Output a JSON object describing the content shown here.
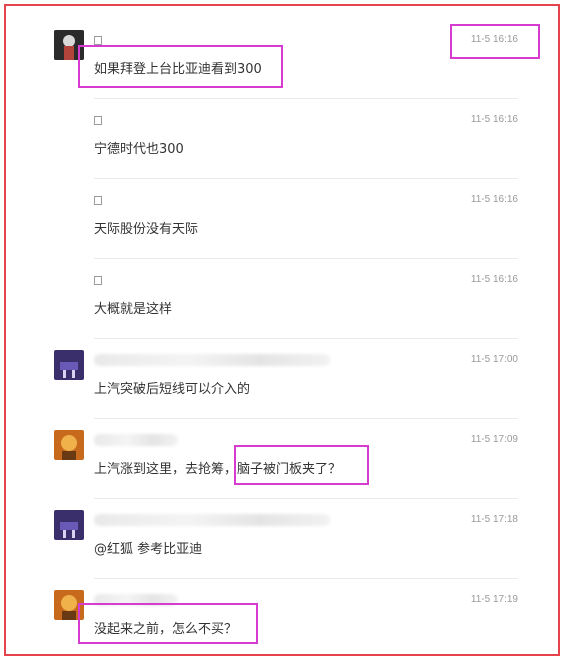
{
  "comments": [
    {
      "time": "11-5 16:16",
      "text": "如果拜登上台比亚迪看到300"
    },
    {
      "time": "11-5 16:16",
      "text": "宁德时代也300"
    },
    {
      "time": "11-5 16:16",
      "text": "天际股份没有天际"
    },
    {
      "time": "11-5 16:16",
      "text": "大概就是这样"
    },
    {
      "time": "11-5 17:00",
      "text": "上汽突破后短线可以介入的"
    },
    {
      "time": "11-5 17:09",
      "text": "上汽涨到这里，去抢筹，脑子被门板夹了？"
    },
    {
      "time": "11-5 17:18",
      "text": "@红狐 参考比亚迪"
    },
    {
      "time": "11-5 17:19",
      "text": "没起来之前，怎么不买？"
    }
  ],
  "colors": {
    "frame_border": "#e8434d",
    "highlight_box": "#d63ccf",
    "timestamp": "#999999",
    "divider": "#ebebeb"
  },
  "icons": [
    "avatar-image",
    "missing-glyph-username"
  ]
}
